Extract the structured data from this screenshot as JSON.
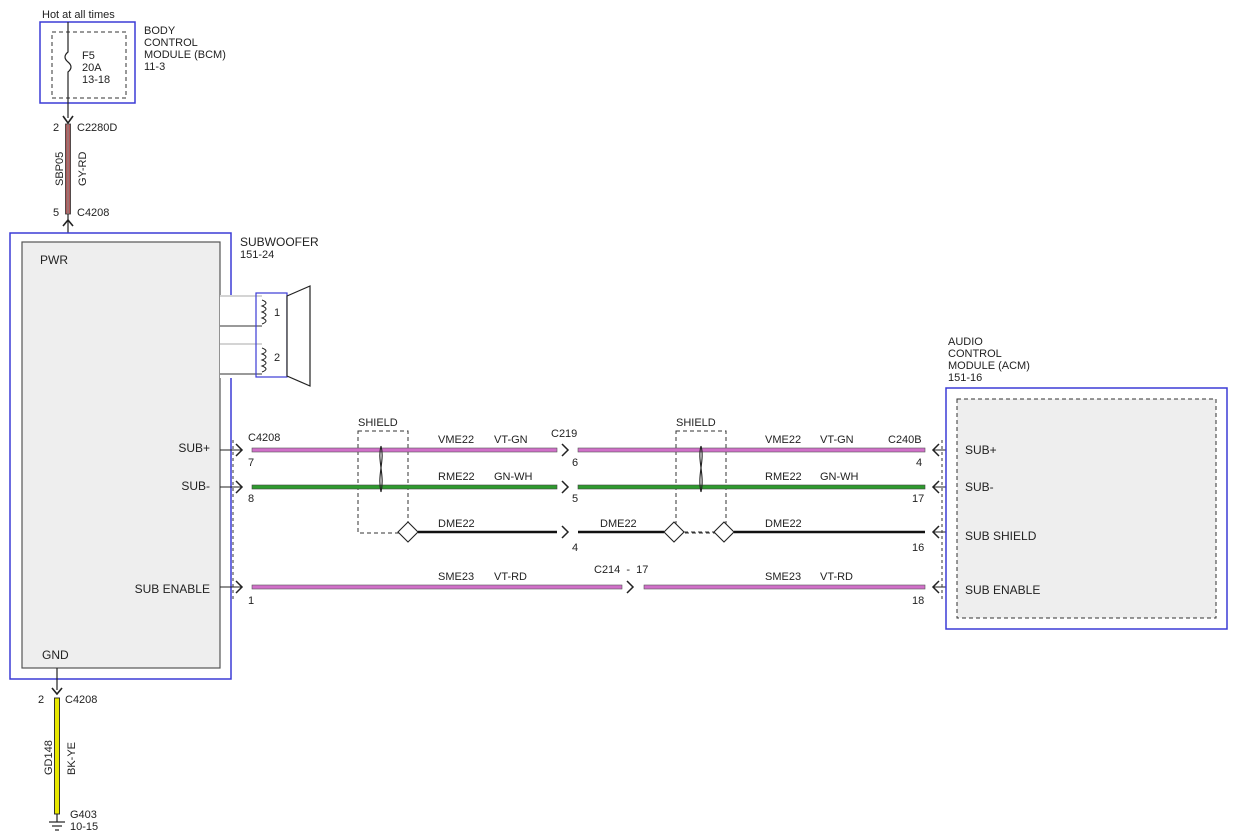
{
  "bcm": {
    "hot_label": "Hot at all times",
    "fuse_name": "F5",
    "fuse_rating": "20A",
    "fuse_ref": "13-18",
    "name_line1": "BODY",
    "name_line2": "CONTROL",
    "name_line3": "MODULE (BCM)",
    "ref": "11-3"
  },
  "power_circuit": {
    "top_pin": "2",
    "top_connector": "C2280D",
    "circuit": "SBP05",
    "color": "GY-RD",
    "bottom_pin": "5",
    "bottom_connector": "C4208"
  },
  "subwoofer": {
    "name": "SUBWOOFER",
    "ref": "151-24",
    "pwr_label": "PWR",
    "gnd_label": "GND",
    "coil1": "1",
    "coil2": "2",
    "pins": {
      "sub_plus": "SUB+",
      "sub_minus": "SUB-",
      "sub_enable": "SUB ENABLE"
    }
  },
  "ground_circuit": {
    "pin": "2",
    "connector": "C4208",
    "circuit": "GD148",
    "color": "BK-YE",
    "ground_name": "G403",
    "ground_ref": "10-15"
  },
  "acm": {
    "name_line1": "AUDIO",
    "name_line2": "CONTROL",
    "name_line3": "MODULE (ACM)",
    "ref": "151-16",
    "pins": {
      "sub_plus": "SUB+",
      "sub_minus": "SUB-",
      "sub_shield": "SUB SHIELD",
      "sub_enable": "SUB ENABLE"
    }
  },
  "connectors": {
    "left": "C4208",
    "middle": "C219",
    "right": "C240B",
    "inline_enable": "C214  -  17"
  },
  "shield_label": "SHIELD",
  "wires": {
    "vme": {
      "circuit": "VME22",
      "color": "VT-GN",
      "left_pin": "7",
      "mid_pin": "6",
      "right_pin": "4"
    },
    "rme": {
      "circuit": "RME22",
      "color": "GN-WH",
      "left_pin": "8",
      "mid_pin": "5",
      "right_pin": "17"
    },
    "dme": {
      "circuit": "DME22",
      "mid_pin": "4",
      "right_pin": "16"
    },
    "sme": {
      "circuit": "SME23",
      "color": "VT-RD",
      "left_pin": "1",
      "right_pin": "18"
    }
  },
  "colors": {
    "module_outline": "#3b3bd6",
    "module_fill": "#eeeeee",
    "wire_violet": "#d070c8",
    "wire_green": "#2e9a2e",
    "wire_gray_red": "#b05858",
    "wire_black_yellow": "#e8e800"
  }
}
